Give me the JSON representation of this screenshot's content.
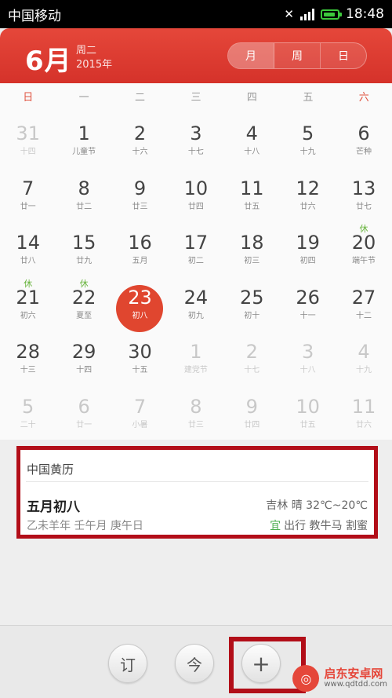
{
  "status_bar": {
    "carrier": "中国移动",
    "time": "18:48"
  },
  "header": {
    "month": "6月",
    "weekday": "周二",
    "year": "2015年",
    "view_tabs": [
      "月",
      "周",
      "日"
    ],
    "active_tab": "月"
  },
  "weekdays": [
    "日",
    "一",
    "二",
    "三",
    "四",
    "五",
    "六"
  ],
  "days": [
    {
      "num": "31",
      "sub": "十四",
      "other": true
    },
    {
      "num": "1",
      "sub": "儿童节"
    },
    {
      "num": "2",
      "sub": "十六"
    },
    {
      "num": "3",
      "sub": "十七"
    },
    {
      "num": "4",
      "sub": "十八"
    },
    {
      "num": "5",
      "sub": "十九"
    },
    {
      "num": "6",
      "sub": "芒种"
    },
    {
      "num": "7",
      "sub": "廿一"
    },
    {
      "num": "8",
      "sub": "廿二"
    },
    {
      "num": "9",
      "sub": "廿三"
    },
    {
      "num": "10",
      "sub": "廿四"
    },
    {
      "num": "11",
      "sub": "廿五"
    },
    {
      "num": "12",
      "sub": "廿六"
    },
    {
      "num": "13",
      "sub": "廿七"
    },
    {
      "num": "14",
      "sub": "廿八"
    },
    {
      "num": "15",
      "sub": "廿九"
    },
    {
      "num": "16",
      "sub": "五月"
    },
    {
      "num": "17",
      "sub": "初二"
    },
    {
      "num": "18",
      "sub": "初三"
    },
    {
      "num": "19",
      "sub": "初四"
    },
    {
      "num": "20",
      "sub": "端午节",
      "rest": "休"
    },
    {
      "num": "21",
      "sub": "初六",
      "rest": "休"
    },
    {
      "num": "22",
      "sub": "夏至",
      "rest": "休"
    },
    {
      "num": "23",
      "sub": "初八",
      "today": true
    },
    {
      "num": "24",
      "sub": "初九"
    },
    {
      "num": "25",
      "sub": "初十"
    },
    {
      "num": "26",
      "sub": "十一"
    },
    {
      "num": "27",
      "sub": "十二"
    },
    {
      "num": "28",
      "sub": "十三"
    },
    {
      "num": "29",
      "sub": "十四"
    },
    {
      "num": "30",
      "sub": "十五"
    },
    {
      "num": "1",
      "sub": "建党节",
      "other": true
    },
    {
      "num": "2",
      "sub": "十七",
      "other": true
    },
    {
      "num": "3",
      "sub": "十八",
      "other": true
    },
    {
      "num": "4",
      "sub": "十九",
      "other": true
    },
    {
      "num": "5",
      "sub": "二十",
      "other": true
    },
    {
      "num": "6",
      "sub": "廿一",
      "other": true
    },
    {
      "num": "7",
      "sub": "小暑",
      "other": true
    },
    {
      "num": "8",
      "sub": "廿三",
      "other": true
    },
    {
      "num": "9",
      "sub": "廿四",
      "other": true
    },
    {
      "num": "10",
      "sub": "廿五",
      "other": true
    },
    {
      "num": "11",
      "sub": "廿六",
      "other": true
    }
  ],
  "almanac": {
    "title": "中国黄历",
    "lunar_date": "五月初八",
    "ganzhi": "乙未羊年 壬午月 庚午日",
    "weather": "吉林 晴 32℃~20℃",
    "yi_label": "宜",
    "yi_items": "出行 教牛马 割蜜"
  },
  "toolbar": {
    "subscribe": "订",
    "today": "今",
    "add": "+"
  },
  "watermark": {
    "name": "启东安卓网",
    "url": "www.qdtdd.com"
  },
  "colors": {
    "accent": "#e0462f",
    "rest": "#67b33c",
    "highlight_box": "#b20e18"
  }
}
